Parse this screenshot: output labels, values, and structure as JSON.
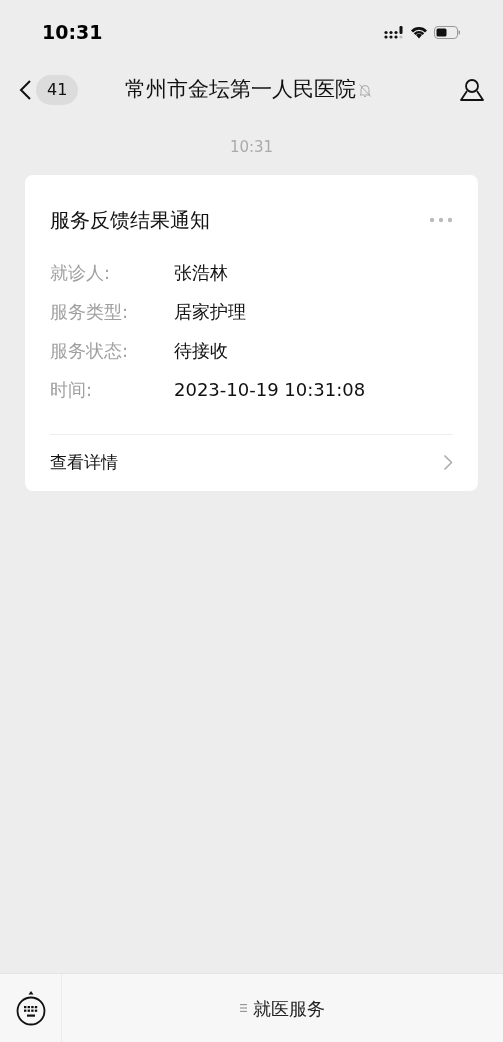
{
  "status_bar": {
    "time": "10:31"
  },
  "header": {
    "unread_count": "41",
    "title": "常州市金坛第一人民医院",
    "muted": true
  },
  "messages": [
    {
      "timestamp": "10:31",
      "card": {
        "title": "服务反馈结果通知",
        "fields": [
          {
            "label": "就诊人:",
            "value": "张浩林"
          },
          {
            "label": "服务类型:",
            "value": "居家护理"
          },
          {
            "label": "服务状态:",
            "value": "待接收"
          },
          {
            "label": "时间:",
            "value": "2023-10-19 10:31:08"
          }
        ],
        "link": "查看详情"
      }
    }
  ],
  "bottom_bar": {
    "menu": "就医服务"
  }
}
